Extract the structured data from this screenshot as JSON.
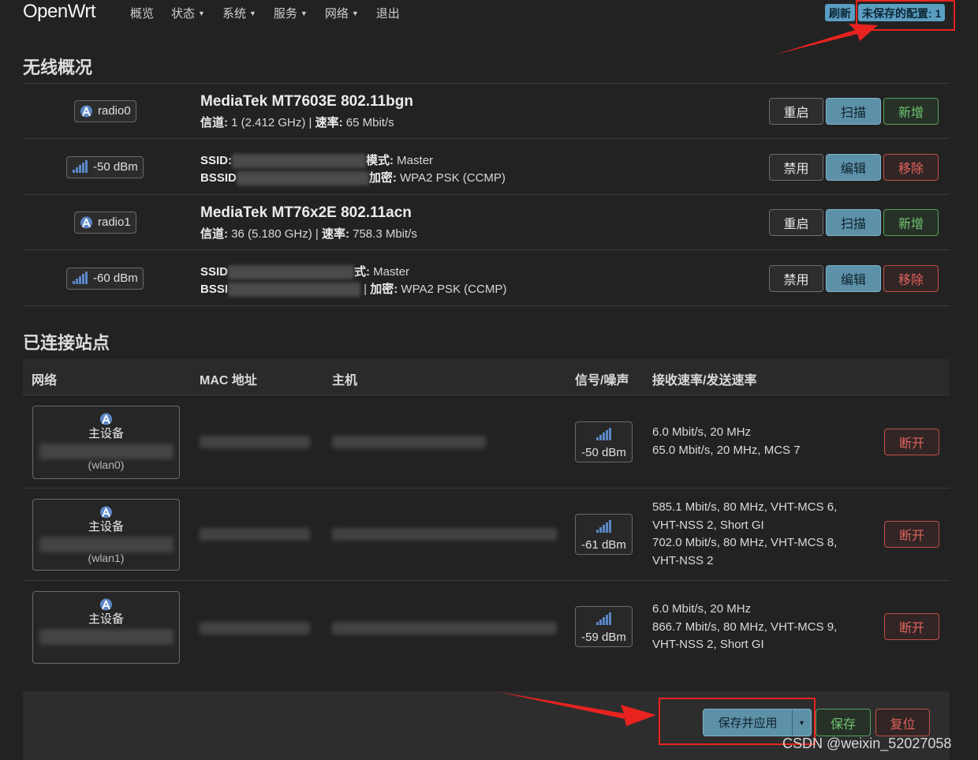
{
  "nav": {
    "brand": "OpenWrt",
    "menu": [
      {
        "label": "概览",
        "has_dropdown": false
      },
      {
        "label": "状态",
        "has_dropdown": true
      },
      {
        "label": "系统",
        "has_dropdown": true
      },
      {
        "label": "服务",
        "has_dropdown": true
      },
      {
        "label": "网络",
        "has_dropdown": true
      },
      {
        "label": "退出",
        "has_dropdown": false
      }
    ],
    "refresh_label": "刷新",
    "unsaved_label": "未保存的配置: 1"
  },
  "wireless": {
    "title": "无线概况",
    "radios": [
      {
        "badge": "radio0",
        "title": "MediaTek MT7603E 802.11bgn",
        "channel_label": "信道:",
        "channel_value": " 1 (2.412 GHz) | ",
        "rate_label": "速率:",
        "rate_value": " 65 Mbit/s",
        "buttons": {
          "restart": "重启",
          "scan": "扫描",
          "add": "新增"
        },
        "network": {
          "signal": "-50 dBm",
          "ssid_label": "SSID:",
          "mode_label": "模式:",
          "mode_value": " Master",
          "bssid_label": "BSSID",
          "enc_label": "加密:",
          "enc_value": " WPA2 PSK (CCMP)",
          "buttons": {
            "disable": "禁用",
            "edit": "编辑",
            "remove": "移除"
          }
        }
      },
      {
        "badge": "radio1",
        "title": "MediaTek MT76x2E 802.11acn",
        "channel_label": "信道:",
        "channel_value": " 36 (5.180 GHz) | ",
        "rate_label": "速率:",
        "rate_value": " 758.3 Mbit/s",
        "buttons": {
          "restart": "重启",
          "scan": "扫描",
          "add": "新增"
        },
        "network": {
          "signal": "-60 dBm",
          "ssid_label": "SSID",
          "mode_label": "式:",
          "mode_value": " Master",
          "bssid_label": "BSSI",
          "enc_sep": " | ",
          "enc_label": "加密:",
          "enc_value": " WPA2 PSK (CCMP)",
          "buttons": {
            "disable": "禁用",
            "edit": "编辑",
            "remove": "移除"
          }
        }
      }
    ]
  },
  "stations": {
    "title": "已连接站点",
    "columns": [
      "网络",
      "MAC 地址",
      "主机",
      "信号/噪声",
      "接收速率/发送速率"
    ],
    "rows": [
      {
        "net_title": "主设备",
        "iface": "(wlan0)",
        "signal": "-50 dBm",
        "rates": [
          "6.0 Mbit/s, 20 MHz",
          "65.0 Mbit/s, 20 MHz, MCS 7"
        ],
        "disconnect": "断开"
      },
      {
        "net_title": "主设备",
        "iface": "(wlan1)",
        "signal": "-61 dBm",
        "rates": [
          "585.1 Mbit/s, 80 MHz, VHT-MCS 6,",
          "VHT-NSS 2, Short GI",
          "702.0 Mbit/s, 80 MHz, VHT-MCS 8,",
          "VHT-NSS 2"
        ],
        "disconnect": "断开"
      },
      {
        "net_title": "主设备",
        "iface": "",
        "signal": "-59 dBm",
        "rates": [
          "6.0 Mbit/s, 20 MHz",
          "866.7 Mbit/s, 80 MHz, VHT-MCS 9,",
          "VHT-NSS 2, Short GI"
        ],
        "disconnect": "断开"
      }
    ]
  },
  "footer": {
    "save_apply": "保存并应用",
    "save": "保存",
    "reset": "复位"
  },
  "watermark": "CSDN @weixin_52027058",
  "colors": {
    "background": "#222222",
    "primary": "#5d91a8",
    "positive": "#56a15a",
    "negative": "#c24f47",
    "annotation": "#e8231f"
  }
}
